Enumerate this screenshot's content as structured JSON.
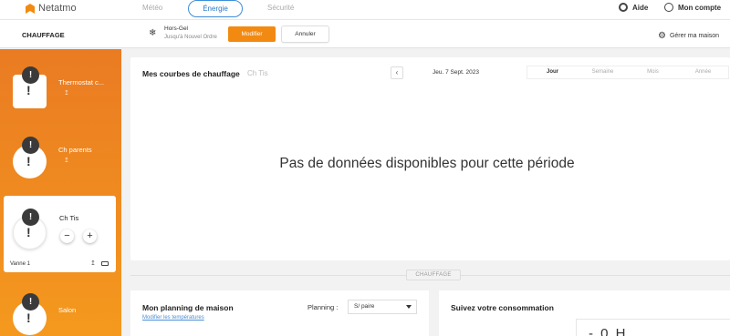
{
  "header": {
    "logo_text": "Netatmo",
    "tabs": [
      "Météo",
      "Énergie",
      "Sécurité"
    ],
    "active_tab": "Énergie",
    "help_label": "Aide",
    "account_label": "Mon compte"
  },
  "subbar": {
    "title": "CHAUFFAGE",
    "mode_name": "Hors-Gel",
    "mode_sub": "Jusqu'à Nouvel Ordre",
    "modify_label": "Modifier",
    "cancel_label": "Annuler",
    "manage_label": "Gérer ma maison"
  },
  "sidebar": {
    "rooms": [
      {
        "name": "Thermostat c...",
        "badge": "!",
        "status_icon": "!",
        "sub_icon": "↥"
      },
      {
        "name": "Ch parents",
        "badge": "!",
        "status_icon": "!",
        "sub_icon": "↥"
      },
      {
        "name": "Ch Tis",
        "badge": "!",
        "status_icon": "!",
        "device": "Vanne 1",
        "minus": "−",
        "plus": "+"
      },
      {
        "name": "Salon",
        "badge": "!",
        "status_icon": "!"
      }
    ]
  },
  "chart": {
    "title": "Mes courbes de chauffage",
    "room": "Ch Tis",
    "prev": "‹",
    "date": "Jeu. 7 Sept. 2023",
    "periods": [
      "Jour",
      "Semaine",
      "Mois",
      "Année"
    ],
    "active_period": "Jour",
    "no_data": "Pas de données disponibles pour cette période"
  },
  "section_label": "CHAUFFAGE",
  "planning": {
    "title": "Mon planning de maison",
    "link": "Modifier les températures",
    "label": "Planning :",
    "selected": "S/ paire"
  },
  "conso": {
    "title": "Suivez votre consommation",
    "value": "- 0 H"
  },
  "colors": {
    "accent_orange": "#f28a12",
    "tab_blue": "#2b78c7",
    "link_blue": "#4a8fd3"
  }
}
